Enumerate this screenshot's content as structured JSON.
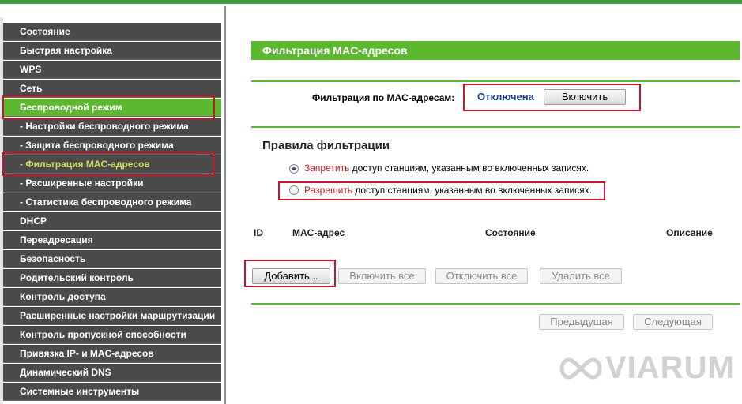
{
  "sidebar": {
    "items": [
      {
        "label": "Состояние"
      },
      {
        "label": "Быстрая настройка"
      },
      {
        "label": "WPS"
      },
      {
        "label": "Сеть"
      },
      {
        "label": "Беспроводной режим"
      },
      {
        "label": "- Настройки беспроводного режима"
      },
      {
        "label": "- Защита беспроводного режима"
      },
      {
        "label": "- Фильтрация MAC-адресов"
      },
      {
        "label": "- Расширенные настройки"
      },
      {
        "label": "- Статистика беспроводного режима"
      },
      {
        "label": "DHCP"
      },
      {
        "label": "Переадресация"
      },
      {
        "label": "Безопасность"
      },
      {
        "label": "Родительский контроль"
      },
      {
        "label": "Контроль доступа"
      },
      {
        "label": "Расширенные настройки маршрутизации"
      },
      {
        "label": "Контроль пропускной способности"
      },
      {
        "label": "Привязка IP- и MAC-адресов"
      },
      {
        "label": "Динамический DNS"
      },
      {
        "label": "Системные инструменты"
      }
    ]
  },
  "main": {
    "title": "Фильтрация MAC-адресов",
    "filter_label": "Фильтрация по MAC-адресам:",
    "filter_status": "Отключена",
    "enable_button": "Включить",
    "rules_title": "Правила фильтрации",
    "rule_deny_word": "Запретить",
    "rule_deny_text": " доступ станциям, указанным во включенных записях.",
    "rule_allow_word": "Разрешить",
    "rule_allow_text": " доступ станциям, указанным во включенных записях.",
    "table_headers": {
      "id": "ID",
      "mac": "MAC-адрес",
      "state": "Состояние",
      "desc": "Описание"
    },
    "buttons": {
      "add": "Добавить...",
      "enable_all": "Включить все",
      "disable_all": "Отключить все",
      "delete_all": "Удалить все",
      "prev": "Предыдущая",
      "next": "Следующая"
    }
  },
  "watermark": {
    "text": "VIARUM"
  },
  "colors": {
    "accent": "#5cb82e",
    "sidebar_bg": "#4a4a4a",
    "highlight": "#c4162c",
    "status_text": "#1a3f8a"
  }
}
